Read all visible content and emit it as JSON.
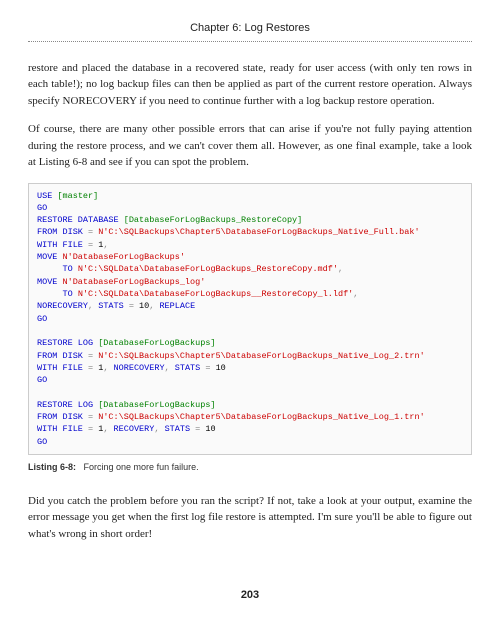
{
  "chapter_title": "Chapter 6: Log Restores",
  "para1": "restore and placed the database in a recovered state, ready for user access (with only ten rows in each table!); no log backup files can then be applied as part of the current restore operation. Always specify NORECOVERY if you need to continue further with a log backup restore operation.",
  "para2": "Of course, there are many other possible errors that can arise if you're not fully paying attention during the restore process, and we can't cover them all. However, as one final example, take a look at Listing 6-8 and see if you can spot the problem.",
  "code": {
    "l01_use": "USE",
    "l01_target": " [master]",
    "l02_go": "GO",
    "l03_restore_db": "RESTORE DATABASE",
    "l03_dbname": " [DatabaseForLogBackups_RestoreCopy]",
    "l04_from_disk": "FROM DISK",
    "l04_eq": " =",
    "l04_path": " N'C:\\SQLBackups\\Chapter5\\DatabaseForLogBackups_Native_Full.bak'",
    "l05_with_file": "WITH FILE",
    "l05_eq": " =",
    "l05_val": " 1",
    "l05_comma": ",",
    "l06_move": "MOVE",
    "l06_name": " N'DatabaseForLogBackups'",
    "l07_to": "     TO",
    "l07_path": " N'C:\\SQLData\\DatabaseForLogBackups_RestoreCopy.mdf'",
    "l07_comma": ",",
    "l08_move": "MOVE",
    "l08_name": " N'DatabaseForLogBackups_log'",
    "l09_to": "     TO",
    "l09_path": " N'C:\\SQLData\\DatabaseForLogBackups__RestoreCopy_l.ldf'",
    "l09_comma": ",",
    "l10_norec": "NORECOVERY",
    "l10_c1": ",",
    "l10_stats": " STATS",
    "l10_eq": " =",
    "l10_val": " 10",
    "l10_c2": ",",
    "l10_replace": " REPLACE",
    "l11_go": "GO",
    "l13_restore_log": "RESTORE LOG",
    "l13_dbname": " [DatabaseForLogBackups]",
    "l14_from_disk": "FROM DISK",
    "l14_eq": " =",
    "l14_path": " N'C:\\SQLBackups\\Chapter5\\DatabaseForLogBackups_Native_Log_2.trn'",
    "l15_with_file": "WITH FILE",
    "l15_eq": " =",
    "l15_val": " 1",
    "l15_c1": ",",
    "l15_norec": " NORECOVERY",
    "l15_c2": ",",
    "l15_stats": " STATS",
    "l15_eq2": " =",
    "l15_val2": " 10",
    "l16_go": "GO",
    "l18_restore_log": "RESTORE LOG",
    "l18_dbname": " [DatabaseForLogBackups]",
    "l19_from_disk": "FROM DISK",
    "l19_eq": " =",
    "l19_path": " N'C:\\SQLBackups\\Chapter5\\DatabaseForLogBackups_Native_Log_1.trn'",
    "l20_with_file": "WITH FILE",
    "l20_eq": " =",
    "l20_val": " 1",
    "l20_c1": ",",
    "l20_rec": " RECOVERY",
    "l20_c2": ",",
    "l20_stats": " STATS",
    "l20_eq2": " =",
    "l20_val2": " 10",
    "l21_go": "GO"
  },
  "listing_label": "Listing 6-8:",
  "listing_caption": "Forcing one more fun failure.",
  "para3": "Did you catch the problem before you ran the script? If not, take a look at your output, examine the error message you get when the first log file restore is attempted. I'm sure you'll be able to figure out what's wrong in short order!",
  "page_number": "203"
}
